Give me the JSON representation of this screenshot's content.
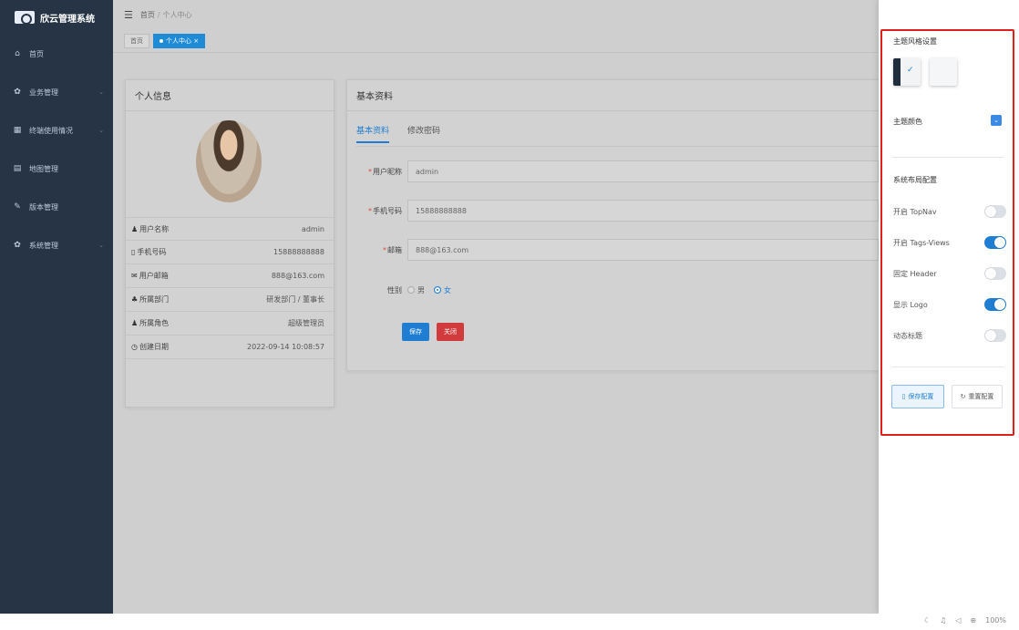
{
  "app": {
    "name": "欣云管理系统"
  },
  "sidebar": {
    "items": [
      {
        "icon": "home-icon",
        "glyph": "⌂",
        "label": "首页",
        "has_arrow": false
      },
      {
        "icon": "gear-icon",
        "glyph": "✿",
        "label": "业务管理",
        "has_arrow": true
      },
      {
        "icon": "grid-icon",
        "glyph": "▦",
        "label": "终端使用情况",
        "has_arrow": true
      },
      {
        "icon": "doc-icon",
        "glyph": "▤",
        "label": "地图管理",
        "has_arrow": false
      },
      {
        "icon": "edit-icon",
        "glyph": "✎",
        "label": "版本管理",
        "has_arrow": false
      },
      {
        "icon": "gear-icon",
        "glyph": "✿",
        "label": "系统管理",
        "has_arrow": true
      }
    ]
  },
  "navbar": {
    "breadcrumb": [
      "首页",
      "个人中心"
    ]
  },
  "tags": [
    {
      "label": "首页",
      "active": false
    },
    {
      "label": "个人中心 ×",
      "active": true
    }
  ],
  "profile": {
    "title": "个人信息",
    "rows": [
      {
        "icon": "user-icon",
        "glyph": "♟",
        "label": "用户名称",
        "value": "admin"
      },
      {
        "icon": "phone-icon",
        "glyph": "▯",
        "label": "手机号码",
        "value": "15888888888"
      },
      {
        "icon": "email-icon",
        "glyph": "✉",
        "label": "用户邮箱",
        "value": "888@163.com"
      },
      {
        "icon": "tree-icon",
        "glyph": "♣",
        "label": "所属部门",
        "value": "研发部门 / 董事长"
      },
      {
        "icon": "peoples-icon",
        "glyph": "♟",
        "label": "所属角色",
        "value": "超级管理员"
      },
      {
        "icon": "date-icon",
        "glyph": "◷",
        "label": "创建日期",
        "value": "2022-09-14 10:08:57"
      }
    ]
  },
  "basic": {
    "title": "基本资料",
    "tabs": [
      {
        "label": "基本资料",
        "active": true
      },
      {
        "label": "修改密码",
        "active": false
      }
    ],
    "fields": {
      "nickname": {
        "label": "用户昵称",
        "value": "admin"
      },
      "phone": {
        "label": "手机号码",
        "value": "15888888888"
      },
      "email": {
        "label": "邮箱",
        "value": "888@163.com"
      }
    },
    "gender": {
      "label": "性别",
      "options": [
        "男",
        "女"
      ],
      "selected": "女"
    },
    "save": "保存",
    "close": "关闭"
  },
  "settings": {
    "theme_style_title": "主题风格设置",
    "theme_color_label": "主题颜色",
    "theme_color": "#3b8ae6",
    "layout_title": "系统布局配置",
    "switches": [
      {
        "label": "开启 TopNav",
        "on": false
      },
      {
        "label": "开启 Tags-Views",
        "on": true
      },
      {
        "label": "固定 Header",
        "on": false
      },
      {
        "label": "显示 Logo",
        "on": true
      },
      {
        "label": "动态标题",
        "on": false
      }
    ],
    "save_btn": "保存配置",
    "reset_btn": "重置配置"
  },
  "status": {
    "zoom": "100%"
  },
  "colors": {
    "sidebar": "#263445",
    "accent": "#1f7ed1",
    "danger": "#d23b3b",
    "highlight": "#e0201b"
  }
}
